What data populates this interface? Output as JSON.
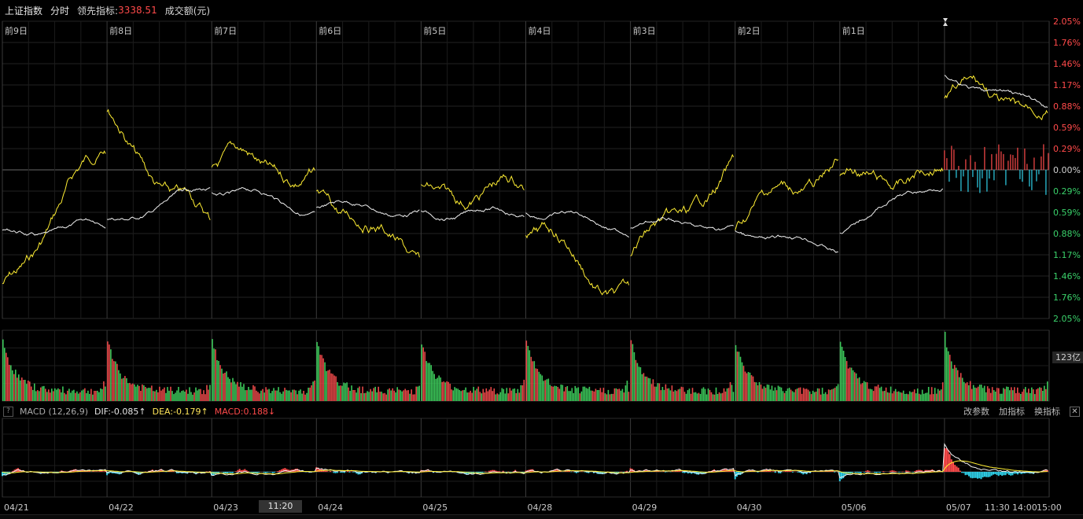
{
  "header": {
    "index_name": "上证指数",
    "mode": "分时",
    "leader_label": "领先指标:",
    "leader_value": "3338.51",
    "turnover_label": "成交额(元)"
  },
  "day_labels": [
    "前9日",
    "前8日",
    "前7日",
    "前6日",
    "前5日",
    "前4日",
    "前3日",
    "前2日",
    "前1日"
  ],
  "right_axis_labels": [
    "2.05%",
    "1.76%",
    "1.46%",
    "1.17%",
    "0.88%",
    "0.59%",
    "0.29%",
    "0.00%",
    "0.29%",
    "0.59%",
    "0.88%",
    "1.17%",
    "1.46%",
    "1.76%",
    "2.05%"
  ],
  "volume_badge": "123亿",
  "macd": {
    "help": "?",
    "name": "MACD (12,26,9)",
    "dif": "DIF:-0.085↑",
    "dea": "DEA:-0.179↑",
    "macd": "MACD:0.188↓",
    "modify_params": "改参数",
    "add_indicator": "加指标",
    "switch_indicator": "换指标",
    "close": "✕"
  },
  "date_labels": [
    "04/21",
    "04/22",
    "04/23",
    "04/24",
    "04/25",
    "04/28",
    "04/29",
    "04/30",
    "05/06",
    "05/07"
  ],
  "time_labels": [
    "11:30",
    "14:00",
    "15:00"
  ],
  "crosshair_time": "11:20",
  "colors": {
    "up": "#ff4a4a",
    "down": "#2fd0e8",
    "yellow_line": "#ffee33",
    "white_line": "#f0f0f0",
    "vol_green": "#3cc85a",
    "vol_red": "#e84848"
  }
}
